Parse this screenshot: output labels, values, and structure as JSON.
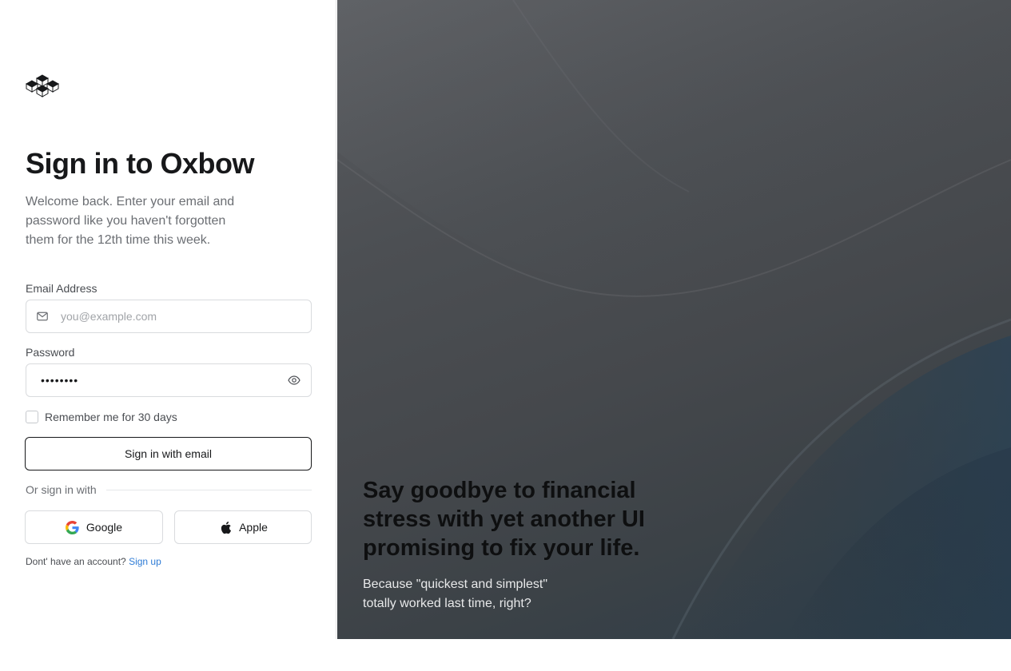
{
  "brand": {
    "logo_icon": "cubes-logo-icon"
  },
  "login": {
    "title": "Sign in to Oxbow",
    "subtitle": "Welcome back. Enter your email and password like you haven't forgotten them for the 12th time this week.",
    "email": {
      "label": "Email Address",
      "placeholder": "you@example.com",
      "icon": "mail-icon"
    },
    "password": {
      "label": "Password",
      "value": "••••••••",
      "icon": "eye-icon"
    },
    "remember_label": "Remember me for 30 days",
    "remember_checked": false,
    "submit_label": "Sign in with email",
    "divider_text": "Or sign in with",
    "social": {
      "google_label": "Google",
      "apple_label": "Apple"
    },
    "signup_prompt": "Dont' have an account?",
    "signup_link": "Sign up"
  },
  "hero": {
    "heading": "Say goodbye to financial stress with yet another UI promising to fix your life.",
    "subheading": "Because \"quickest and simplest\" totally worked last time, right?"
  },
  "colors": {
    "link": "#2f7cd6",
    "text_primary": "#17181a",
    "text_secondary": "#6b6e73",
    "panel_dark": "#45484c"
  }
}
